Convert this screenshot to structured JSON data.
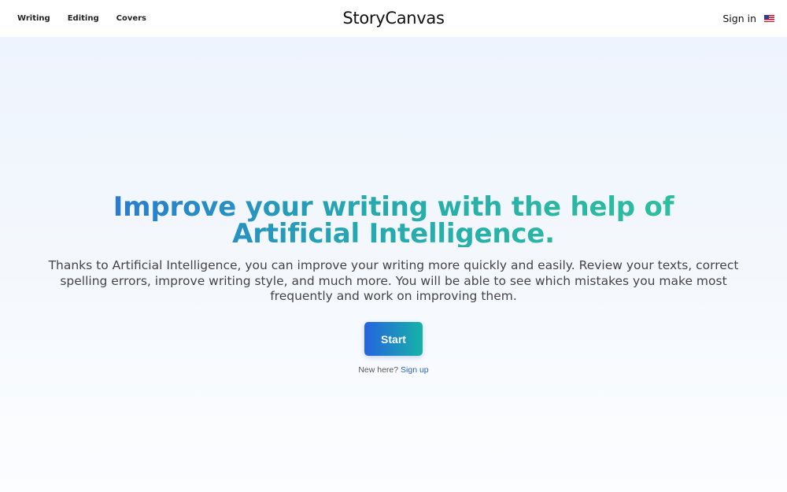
{
  "header": {
    "nav": [
      {
        "label": "Writing"
      },
      {
        "label": "Editing"
      },
      {
        "label": "Covers"
      }
    ],
    "brand": "StoryCanvas",
    "sign_in": "Sign in",
    "language_icon": "us-flag-icon"
  },
  "hero": {
    "headline": "Improve your writing with the help of Artificial Intelligence.",
    "subtext": "Thanks to Artificial Intelligence, you can improve your writing more quickly and easily. Review your texts, correct spelling errors, improve writing style, and much more. You will be able to see which mistakes you make most frequently and work on improving them.",
    "start_label": "Start",
    "new_here": "New here?",
    "sign_up": "Sign up"
  },
  "colors": {
    "gradient_start": "#2563e0",
    "gradient_end": "#2fc39a",
    "link": "#2a62c9",
    "hero_background": "#eef4fd"
  }
}
